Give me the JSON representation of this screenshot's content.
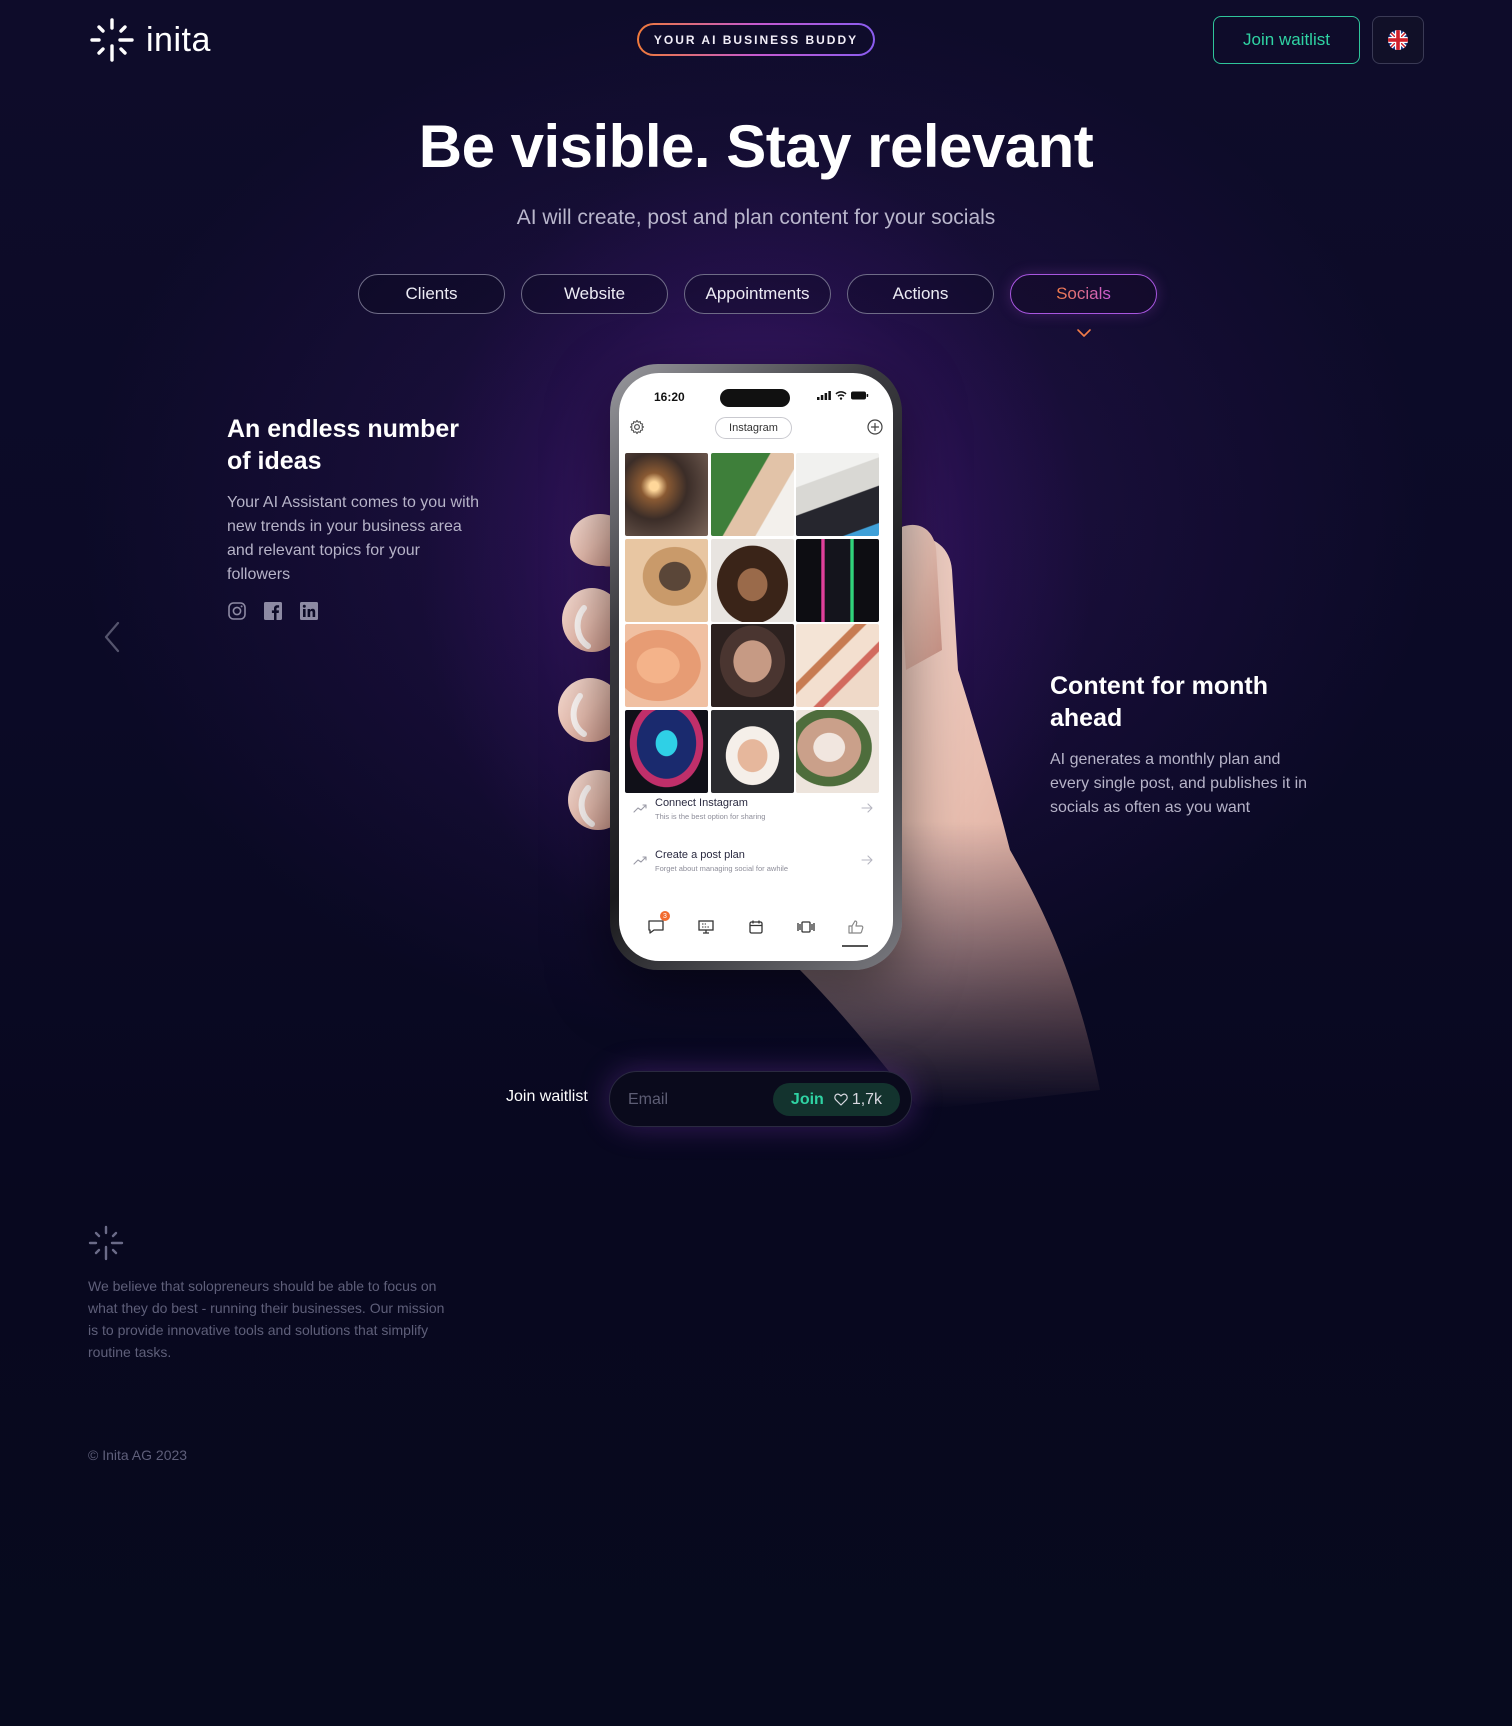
{
  "header": {
    "logo_text": "inita",
    "tagline": "YOUR AI BUSINESS BUDDY",
    "join_label": "Join waitlist",
    "language_icon": "uk-flag-icon"
  },
  "hero": {
    "title": "Be visible. Stay relevant",
    "subtitle": "AI will create, post and plan content for your socials"
  },
  "tabs": [
    {
      "label": "Clients",
      "active": false
    },
    {
      "label": "Website",
      "active": false
    },
    {
      "label": "Appointments",
      "active": false
    },
    {
      "label": "Actions",
      "active": false
    },
    {
      "label": "Socials",
      "active": true
    }
  ],
  "feature_left": {
    "title": "An endless number of ideas",
    "description": "Your AI Assistant comes to you with new trends in your business area and relevant topics for your followers",
    "icons": [
      "instagram-icon",
      "facebook-icon",
      "linkedin-icon"
    ]
  },
  "feature_right": {
    "title": "Content for month ahead",
    "description": "AI generates a monthly plan and every single post, and publishes it in socials as often as you want"
  },
  "phone": {
    "time": "16:20",
    "platform_chip": "Instagram",
    "actions": [
      {
        "title": "Connect Instagram",
        "subtitle": "This is the best option for sharing"
      },
      {
        "title": "Create a post plan",
        "subtitle": "Forget about managing social for awhile"
      }
    ],
    "notification_badge": "3",
    "tabbar_icons": [
      "chat-icon",
      "presentation-icon",
      "calendar-icon",
      "carousel-icon",
      "thumbs-up-icon"
    ]
  },
  "waitlist": {
    "label": "Join waitlist",
    "email_placeholder": "Email",
    "join_label": "Join",
    "count": "1,7k"
  },
  "footer": {
    "mission": "We believe that solopreneurs should be able to focus on what they do best - running their businesses. Our mission is to provide innovative tools and solutions that simplify routine tasks.",
    "copyright": "© Inita AG 2023"
  },
  "colors": {
    "accent_green": "#2fd3a3",
    "accent_orange": "#f27c48",
    "accent_purple": "#a856e0",
    "background": "#0b0a26"
  }
}
